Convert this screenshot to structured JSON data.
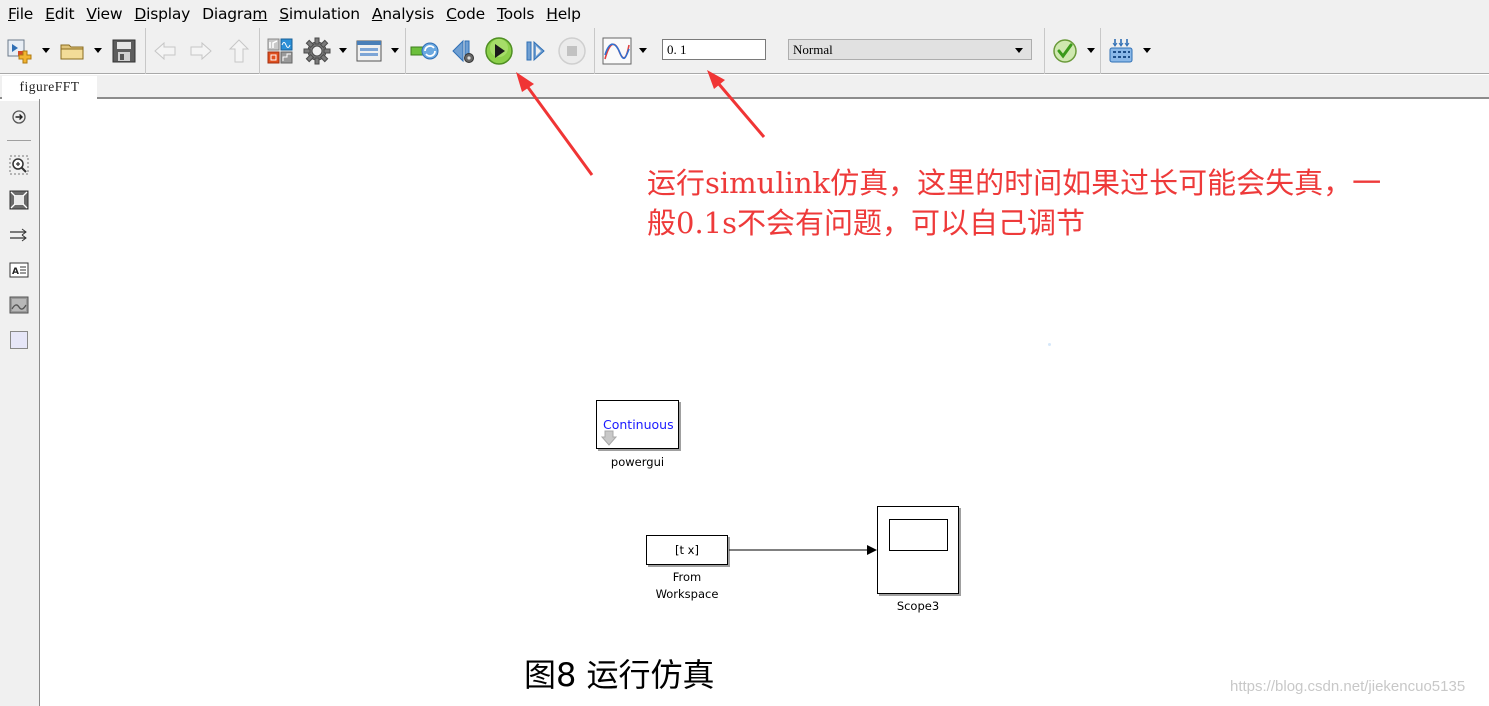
{
  "menu": {
    "items": [
      {
        "acc": "F",
        "rest": "ile"
      },
      {
        "acc": "E",
        "rest": "dit"
      },
      {
        "acc": "V",
        "rest": "iew"
      },
      {
        "acc": "D",
        "rest": "isplay"
      },
      {
        "pre": "Diagra",
        "acc": "m",
        "rest": ""
      },
      {
        "acc": "S",
        "rest": "imulation"
      },
      {
        "acc": "A",
        "rest": "nalysis"
      },
      {
        "acc": "C",
        "rest": "ode"
      },
      {
        "acc": "T",
        "rest": "ools"
      },
      {
        "acc": "H",
        "rest": "elp"
      }
    ]
  },
  "toolbar": {
    "icons": [
      "new-model-icon",
      "open-folder-icon",
      "save-icon",
      "back-icon",
      "forward-icon",
      "up-icon",
      "library-browser-icon",
      "model-config-icon",
      "model-explorer-icon",
      "update-diagram-icon",
      "step-back-icon",
      "run-icon",
      "step-forward-icon",
      "stop-icon",
      "data-inspector-icon",
      "model-advisor-icon",
      "build-icon"
    ],
    "stop_time": "0. 1",
    "sim_mode": "Normal"
  },
  "tabs": [
    {
      "label": "figureFFT"
    }
  ],
  "palette": {
    "icons": [
      "hide-explorer-icon",
      "zoom-icon",
      "fit-to-view-icon",
      "route-lines-icon",
      "annotation-icon",
      "image-icon",
      "area-icon"
    ]
  },
  "diagram": {
    "blocks": {
      "powergui": {
        "content": "Continuous",
        "label": "powergui"
      },
      "from_workspace": {
        "content": "[t x]",
        "label_line1": "From",
        "label_line2": "Workspace"
      },
      "scope": {
        "label": "Scope3"
      }
    }
  },
  "annotation": {
    "line1": "运行simulink仿真，这里的时间如果过长可能会失真，一",
    "line2": "般0.1s不会有问题，可以自己调节",
    "color": "#ee3a3a"
  },
  "caption": "图8  运行仿真",
  "watermark": "https://blog.csdn.net/jiekencuo5135"
}
